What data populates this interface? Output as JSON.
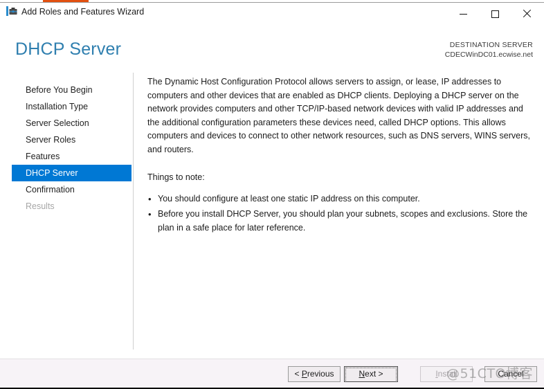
{
  "window": {
    "title": "Add Roles and Features Wizard",
    "icon": "server-roles-icon",
    "controls": {
      "minimize": "Minimize",
      "maximize": "Maximize",
      "close": "Close"
    }
  },
  "header": {
    "page_title": "DHCP Server",
    "destination_label": "DESTINATION SERVER",
    "destination_server": "CDECWinDC01.ecwise.net",
    "title_color": "#2f7faf"
  },
  "sidebar": {
    "selected_color": "#0078d4",
    "items": [
      {
        "label": "Before You Begin",
        "state": "normal"
      },
      {
        "label": "Installation Type",
        "state": "normal"
      },
      {
        "label": "Server Selection",
        "state": "normal"
      },
      {
        "label": "Server Roles",
        "state": "normal"
      },
      {
        "label": "Features",
        "state": "normal"
      },
      {
        "label": "DHCP Server",
        "state": "selected"
      },
      {
        "label": "Confirmation",
        "state": "normal"
      },
      {
        "label": "Results",
        "state": "disabled"
      }
    ]
  },
  "content": {
    "paragraph": "The Dynamic Host Configuration Protocol allows servers to assign, or lease, IP addresses to computers and other devices that are enabled as DHCP clients. Deploying a DHCP server on the network provides computers and other TCP/IP-based network devices with valid IP addresses and the additional configuration parameters these devices need, called DHCP options. This allows computers and devices to connect to other network resources, such as DNS servers, WINS servers, and routers.",
    "things_to_note_label": "Things to note:",
    "notes": [
      "You should configure at least one static IP address on this computer.",
      "Before you install DHCP Server, you should plan your subnets, scopes and exclusions. Store the plan in a safe place for later reference."
    ]
  },
  "footer": {
    "previous_prefix": "< ",
    "previous_mnemonic": "P",
    "previous_rest": "revious",
    "next_mnemonic": "N",
    "next_rest": "ext >",
    "install_mnemonic": "I",
    "install_rest": "nstall",
    "cancel_label": "Cancel"
  },
  "watermark": {
    "text": "@51CTO博客"
  }
}
